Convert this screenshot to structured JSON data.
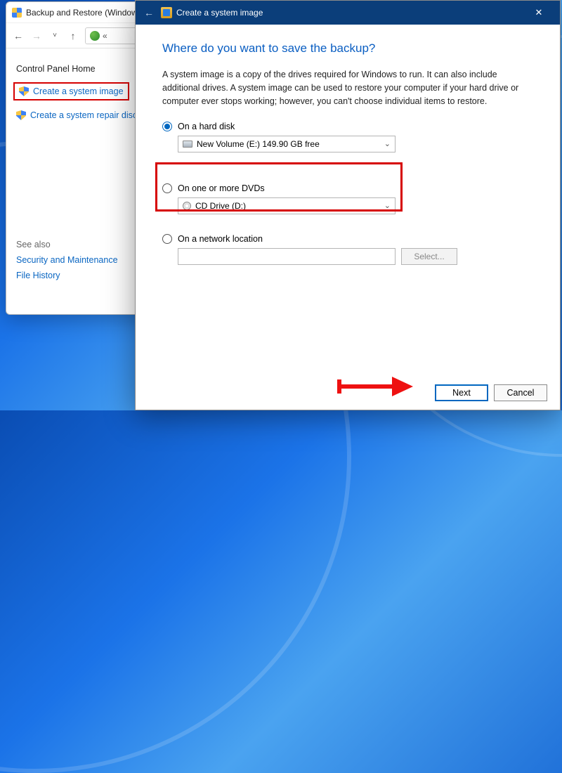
{
  "cp": {
    "title": "Backup and Restore (Window",
    "home": "Control Panel Home",
    "create_image": "Create a system image",
    "create_repair": "Create a system repair disc",
    "see_also": "See also",
    "security": "Security and Maintenance",
    "file_history": "File History",
    "addr_chevrons": "«"
  },
  "wizard": {
    "title": "Create a system image",
    "heading": "Where do you want to save the backup?",
    "description": "A system image is a copy of the drives required for Windows to run. It can also include additional drives. A system image can be used to restore your computer if your hard drive or computer ever stops working; however, you can't choose individual items to restore.",
    "opt_hard_disk": "On a hard disk",
    "hard_disk_value": "New Volume (E:)  149.90 GB free",
    "opt_dvd": "On one or more DVDs",
    "dvd_value": "CD Drive (D:)",
    "opt_network": "On a network location",
    "select_btn": "Select...",
    "next": "Next",
    "cancel": "Cancel"
  }
}
